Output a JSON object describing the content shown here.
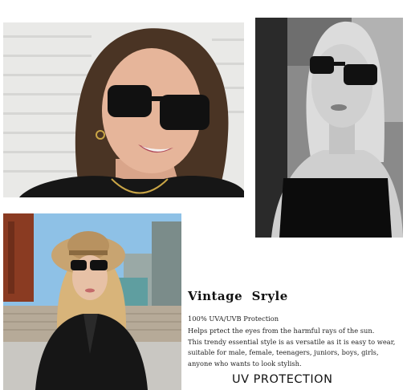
{
  "photos": [
    {
      "subject": "smiling woman with brunette hair wearing black rectangular sunglasses",
      "tone": "color"
    },
    {
      "subject": "blonde woman in black strapless top wearing black rectangular sunglasses",
      "tone": "black-and-white"
    },
    {
      "subject": "blonde woman in straw hat and black blazer wearing sunglasses outdoors",
      "tone": "color"
    }
  ],
  "text": {
    "title": "Vintage  Sryle",
    "lines": [
      "100% UVA/UVB Protection",
      "Helps prtect the eyes from the harmful rays of the sun.",
      "This trendy essential style is as versatile as it is easy to wear,",
      "suitable for male, female, teenagers, juniors, boys, girls,",
      "anyone who wants to look stylish."
    ],
    "footer": "UV PROTECTION"
  }
}
